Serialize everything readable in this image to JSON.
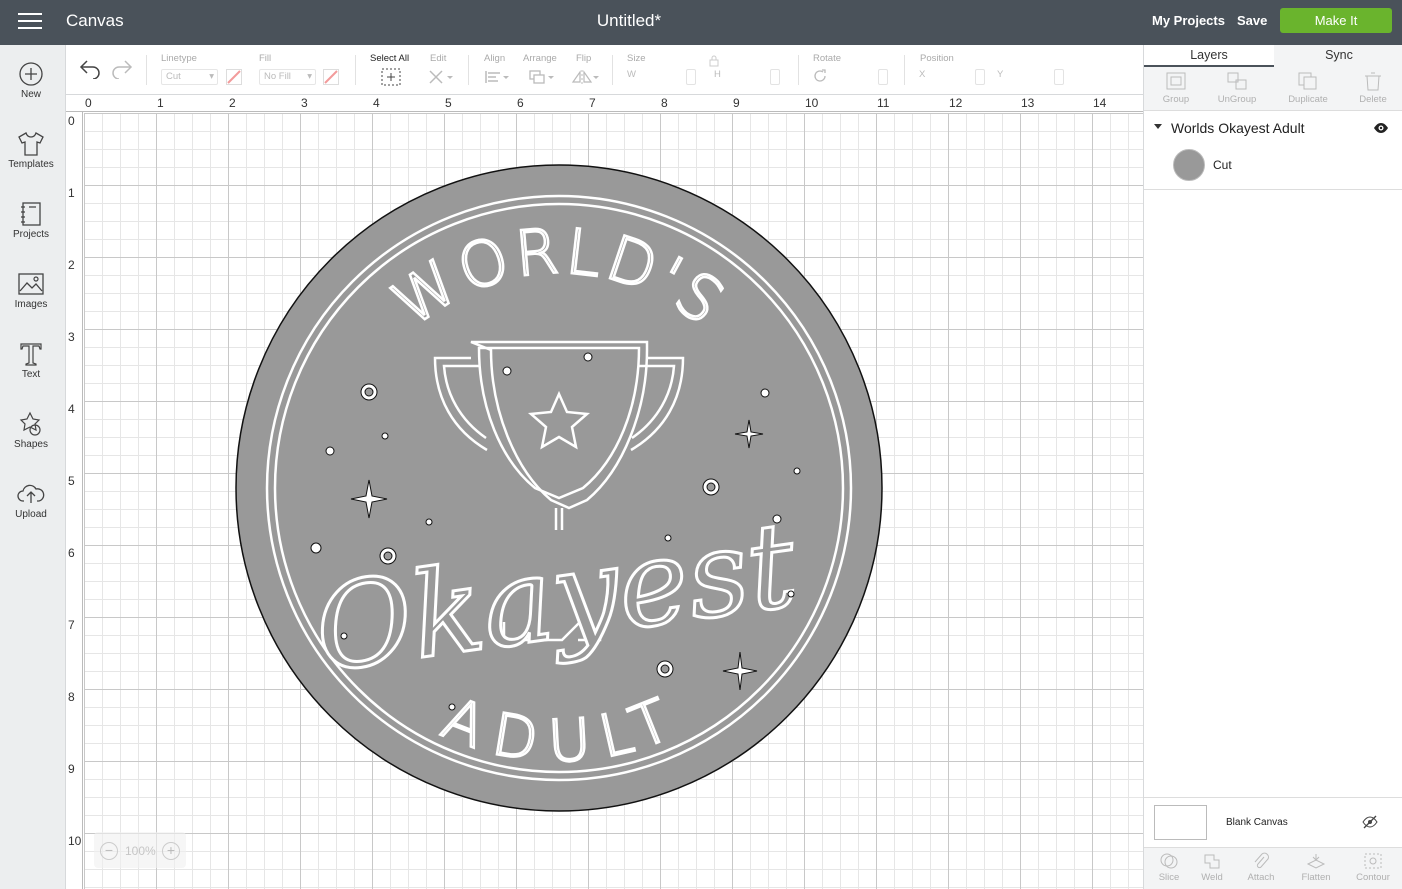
{
  "topbar": {
    "app_title": "Canvas",
    "document_title": "Untitled*",
    "my_projects": "My Projects",
    "save": "Save",
    "make_it": "Make It",
    "make_it_color": "#6ab42d",
    "bar_color": "#4a525a"
  },
  "sidebar": {
    "items": [
      {
        "label": "New",
        "icon": "plus-circle-icon"
      },
      {
        "label": "Templates",
        "icon": "tshirt-icon"
      },
      {
        "label": "Projects",
        "icon": "notebook-icon"
      },
      {
        "label": "Images",
        "icon": "image-icon"
      },
      {
        "label": "Text",
        "icon": "text-T-icon"
      },
      {
        "label": "Shapes",
        "icon": "shapes-icon"
      },
      {
        "label": "Upload",
        "icon": "cloud-upload-icon"
      }
    ]
  },
  "toolbar": {
    "linetype_label": "Linetype",
    "linetype_value": "Cut",
    "fill_label": "Fill",
    "fill_value": "No Fill",
    "select_all": "Select All",
    "edit": "Edit",
    "align": "Align",
    "arrange": "Arrange",
    "flip": "Flip",
    "size": "Size",
    "size_w": "W",
    "size_h": "H",
    "rotate": "Rotate",
    "position": "Position",
    "pos_x": "X",
    "pos_y": "Y"
  },
  "rulers": {
    "top": [
      "0",
      "1",
      "2",
      "3",
      "4",
      "5",
      "6",
      "7",
      "8",
      "9",
      "10",
      "11",
      "12",
      "13",
      "14"
    ],
    "left": [
      "0",
      "1",
      "2",
      "3",
      "4",
      "5",
      "6",
      "7",
      "8",
      "9",
      "10"
    ]
  },
  "design": {
    "top_text": "WORLD'S",
    "script_text": "Okayest",
    "bottom_text": "ADULT",
    "fill_color": "#999999"
  },
  "zoom": {
    "level": "100%"
  },
  "layers_panel": {
    "tabs": [
      "Layers",
      "Sync"
    ],
    "tools": [
      "Group",
      "UnGroup",
      "Duplicate",
      "Delete"
    ],
    "group_name": "Worlds Okayest Adult",
    "layer_name": "Cut",
    "blank_canvas": "Blank Canvas",
    "bottom_tools": [
      "Slice",
      "Weld",
      "Attach",
      "Flatten",
      "Contour"
    ]
  }
}
